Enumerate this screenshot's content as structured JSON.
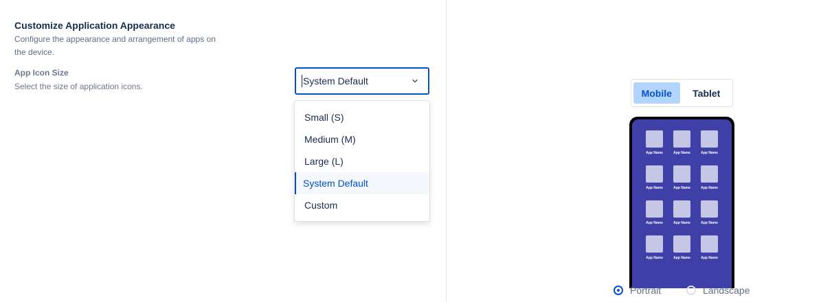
{
  "settings": {
    "title": "Customize Application Appearance",
    "description": "Configure the appearance and arrangement of apps on the device.",
    "icon_size": {
      "label": "App Icon Size",
      "help": "Select the size of application icons.",
      "selected": "System Default",
      "options": [
        {
          "label": "Small (S)",
          "selected": false
        },
        {
          "label": "Medium (M)",
          "selected": false
        },
        {
          "label": "Large (L)",
          "selected": false
        },
        {
          "label": "System Default",
          "selected": true
        },
        {
          "label": "Custom",
          "selected": false
        }
      ]
    }
  },
  "preview": {
    "device_toggle": {
      "options": [
        "Mobile",
        "Tablet"
      ],
      "active": "Mobile"
    },
    "app_label": "App Name",
    "app_count": 12,
    "orientation": {
      "options": [
        "Portrait",
        "Landscape"
      ],
      "selected": "Portrait"
    }
  },
  "colors": {
    "accent": "#0052cc",
    "phone_screen": "#3f3fa8",
    "app_icon": "#c5c5e5",
    "toggle_active_bg": "#b3d4ff"
  }
}
